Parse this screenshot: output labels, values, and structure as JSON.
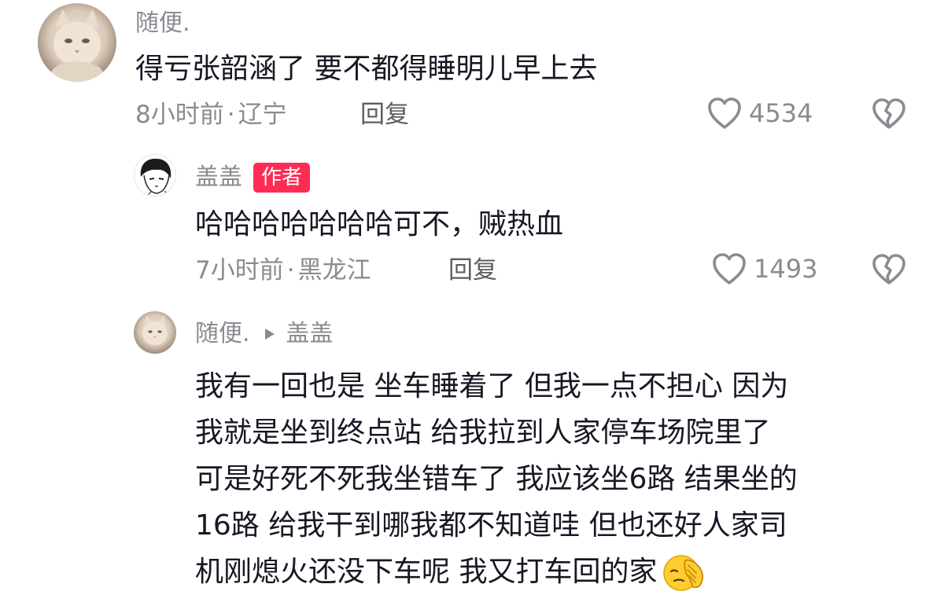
{
  "comments": [
    {
      "author": "随便.",
      "text": "得亏张韶涵了 要不都得睡明儿早上去",
      "time": "8小时前",
      "location": "辽宁",
      "reply_label": "回复",
      "likes": "4534"
    },
    {
      "author": "盖盖",
      "badge": "作者",
      "text": "哈哈哈哈哈哈哈可不，贼热血",
      "time": "7小时前",
      "location": "黑龙江",
      "reply_label": "回复",
      "likes": "1493"
    },
    {
      "author": "随便.",
      "reply_to": "盖盖",
      "lines": [
        "我有一回也是 坐车睡着了 但我一点不担心 因为",
        "我就是坐到终点站 给我拉到人家停车场院里了",
        "可是好死不死我坐错车了 我应该坐6路 结果坐的",
        "16路 给我干到哪我都不知道哇 但也还好人家司",
        "机刚熄火还没下车呢 我又打车回的家"
      ],
      "emoji": "facepalm-emoji"
    }
  ],
  "separator": "·",
  "icons": {
    "like": "heart-outline-icon",
    "dislike": "broken-heart-icon",
    "reply_arrow": "triangle-right-icon"
  },
  "colors": {
    "badge": "#fe2c55",
    "meta": "#8a8b91",
    "text": "#161823"
  }
}
